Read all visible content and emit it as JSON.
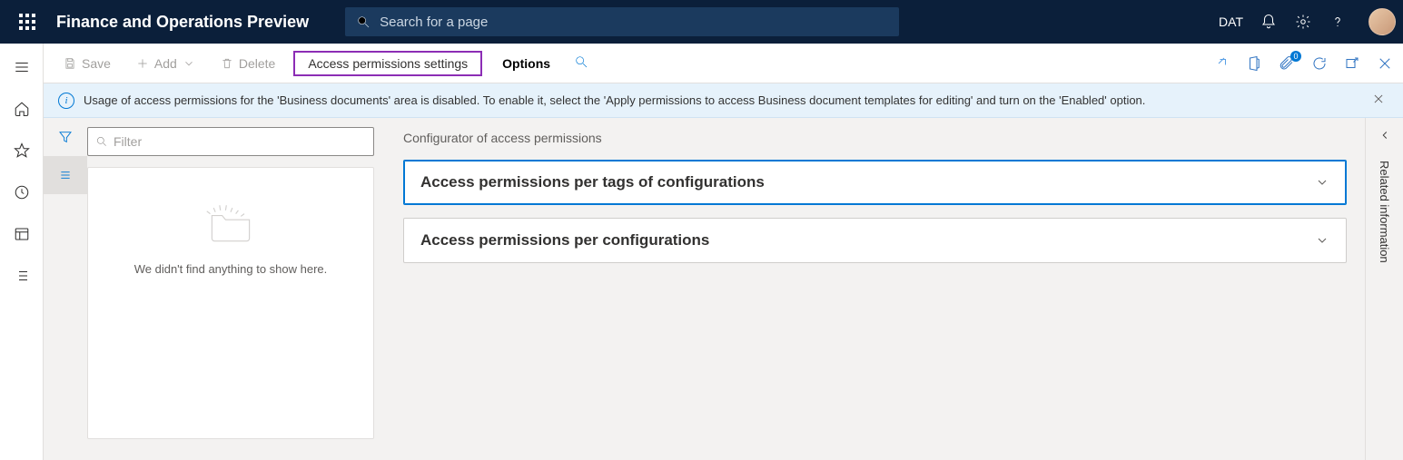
{
  "topbar": {
    "app_title": "Finance and Operations Preview",
    "search_placeholder": "Search for a page",
    "environment": "DAT"
  },
  "cmdbar": {
    "save": "Save",
    "add": "Add",
    "delete": "Delete",
    "highlighted": "Access permissions settings",
    "options": "Options",
    "attach_badge": "0"
  },
  "infobar": {
    "message": "Usage of access permissions for the 'Business documents' area is disabled. To enable it, select the 'Apply permissions to access Business document templates for editing' and turn on the 'Enabled' option."
  },
  "list": {
    "filter_placeholder": "Filter",
    "empty_text": "We didn't find anything to show here."
  },
  "detail": {
    "title": "Configurator of access permissions",
    "section1": "Access permissions per tags of configurations",
    "section2": "Access permissions per configurations"
  },
  "rightrail": {
    "label": "Related information"
  }
}
